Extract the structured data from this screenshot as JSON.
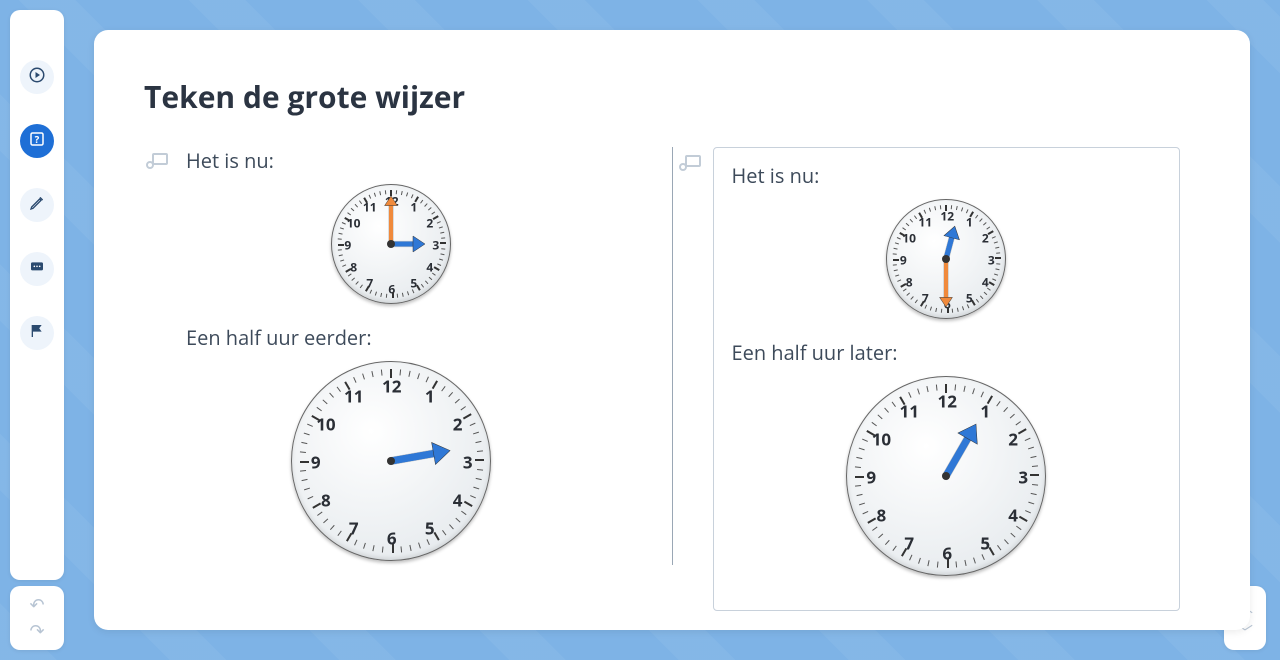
{
  "sidebar": {
    "items": [
      {
        "name": "play-button",
        "icon": "◉"
      },
      {
        "name": "question-button",
        "icon": "?"
      },
      {
        "name": "edit-button",
        "icon": "✎"
      },
      {
        "name": "chat-button",
        "icon": "⋯"
      },
      {
        "name": "flag-button",
        "icon": "⚑"
      }
    ],
    "active_index": 1
  },
  "title": "Teken de grote wijzer",
  "left": {
    "now_label": "Het is nu:",
    "task_label": "Een half uur eerder:",
    "clock_now": {
      "hour_angle": 90,
      "minute_angle": 0,
      "minute_color": "#f08a3c",
      "hour_color": "#2f78d6"
    },
    "clock_task": {
      "hour_angle": 80,
      "hour_color": "#2f78d6"
    }
  },
  "right": {
    "now_label": "Het is nu:",
    "task_label": "Een half uur later:",
    "clock_now": {
      "hour_angle": 15,
      "minute_angle": 180,
      "minute_color": "#f08a3c",
      "hour_color": "#2f78d6"
    },
    "clock_task": {
      "hour_angle": 30,
      "hour_color": "#2f78d6"
    }
  },
  "clock_numbers": [
    "12",
    "1",
    "2",
    "3",
    "4",
    "5",
    "6",
    "7",
    "8",
    "9",
    "10",
    "11"
  ],
  "colors": {
    "accent": "#1e6fd6",
    "bg": "#7eb3e6"
  }
}
